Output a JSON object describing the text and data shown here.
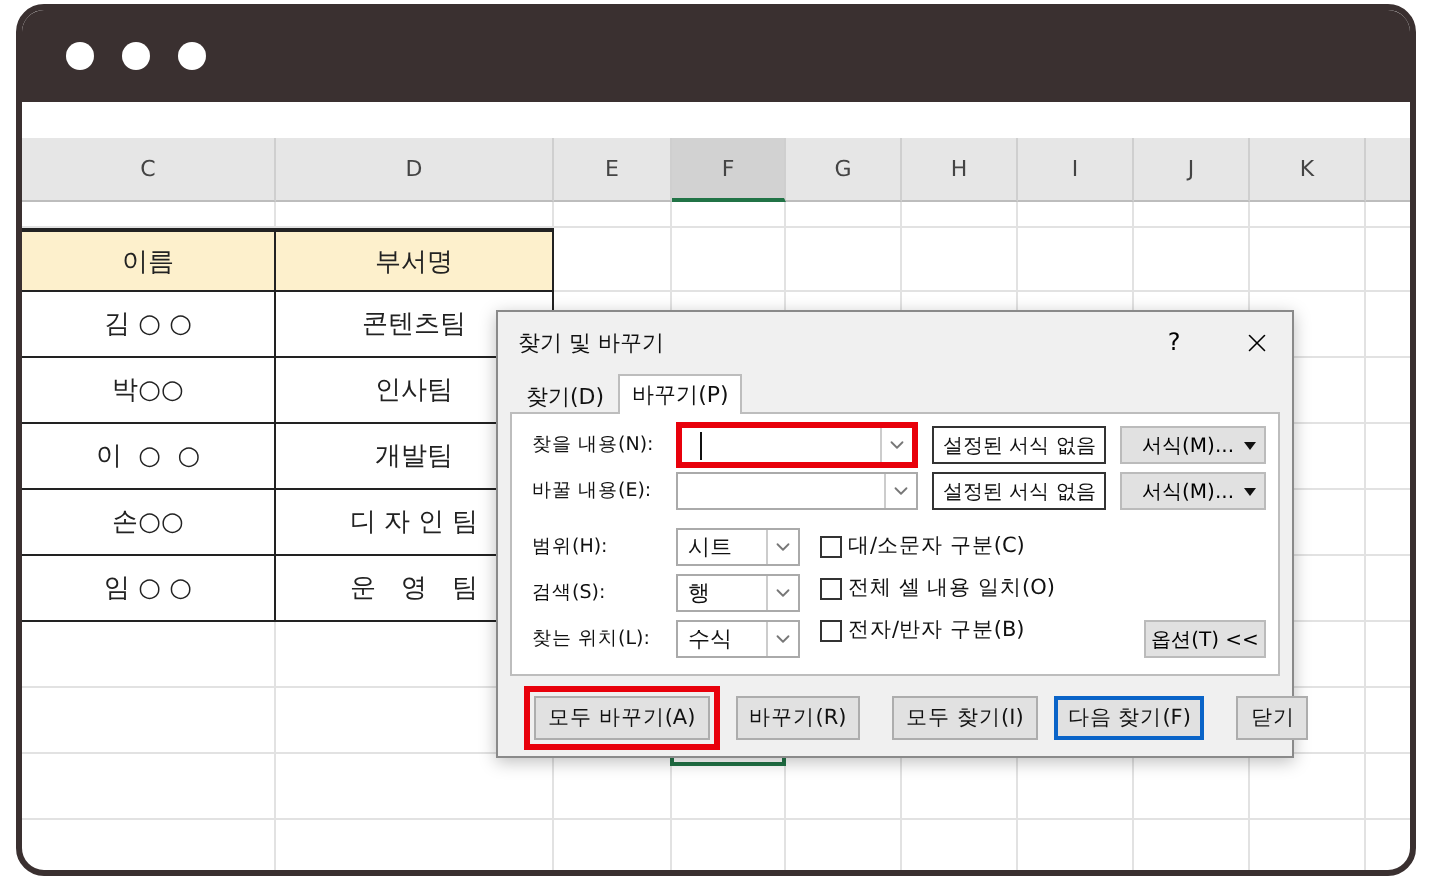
{
  "sheet": {
    "columns": [
      {
        "label": "C",
        "selected": false
      },
      {
        "label": "D",
        "selected": false
      },
      {
        "label": "E",
        "selected": false
      },
      {
        "label": "F",
        "selected": true
      },
      {
        "label": "G",
        "selected": false
      },
      {
        "label": "H",
        "selected": false
      },
      {
        "label": "I",
        "selected": false
      },
      {
        "label": "J",
        "selected": false
      },
      {
        "label": "K",
        "selected": false
      }
    ],
    "rows": [
      {
        "kind": "blank",
        "cells": []
      },
      {
        "kind": "header",
        "cells": [
          {
            "text": "이름"
          },
          {
            "text": "부서명"
          }
        ]
      },
      {
        "kind": "data",
        "cells": [
          {
            "text": "김 ○ ○"
          },
          {
            "text": "콘텐츠팀"
          }
        ]
      },
      {
        "kind": "data",
        "cells": [
          {
            "text": "박○○"
          },
          {
            "text": "인사팀"
          }
        ]
      },
      {
        "kind": "data",
        "cells": [
          {
            "text": "이  ○  ○"
          },
          {
            "text": "개발팀"
          }
        ]
      },
      {
        "kind": "data",
        "cells": [
          {
            "text": "손○○"
          },
          {
            "text": "디 자 인 팀"
          }
        ]
      },
      {
        "kind": "data",
        "cells": [
          {
            "text": "임 ○ ○"
          },
          {
            "text": "운   영   팀"
          }
        ]
      }
    ]
  },
  "dialog": {
    "title": "찾기 및 바꾸기",
    "help": "?",
    "tabs": [
      {
        "label": "찾기(D)",
        "selected": false
      },
      {
        "label": "바꾸기(P)",
        "selected": true
      }
    ],
    "fields": [
      {
        "label": "찾을 내용(N):",
        "highlighted": true,
        "focused": true,
        "format_preview": "설정된 서식 없음",
        "format_button": "서식(M)..."
      },
      {
        "label": "바꿀 내용(E):",
        "highlighted": false,
        "focused": false,
        "format_preview": "설정된 서식 없음",
        "format_button": "서식(M)..."
      }
    ],
    "selects": [
      {
        "label": "범위(H):",
        "value": "시트"
      },
      {
        "label": "검색(S):",
        "value": "행"
      },
      {
        "label": "찾는 위치(L):",
        "value": "수식"
      }
    ],
    "checkboxes": [
      {
        "label": "대/소문자 구분(C)",
        "checked": false
      },
      {
        "label": "전체 셀 내용 일치(O)",
        "checked": false
      },
      {
        "label": "전자/반자 구분(B)",
        "checked": false
      }
    ],
    "options_button": "옵션(T) <<",
    "buttons": [
      {
        "label": "모두 바꾸기(A)",
        "highlighted": true,
        "default": false
      },
      {
        "label": "바꾸기(R)",
        "highlighted": false,
        "default": false
      },
      {
        "label": "모두 찾기(I)",
        "highlighted": false,
        "default": false
      },
      {
        "label": "다음 찾기(F)",
        "highlighted": false,
        "default": true
      },
      {
        "label": "닫기",
        "highlighted": false,
        "default": false
      }
    ]
  }
}
